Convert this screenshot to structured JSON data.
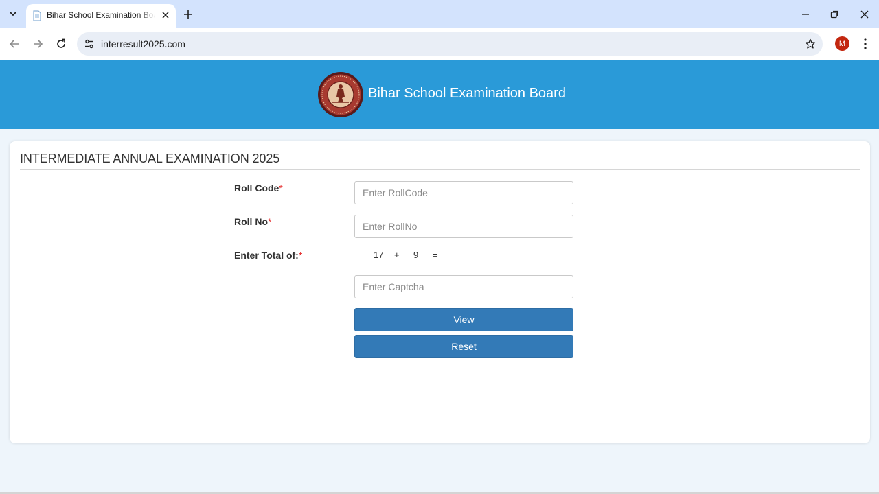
{
  "browser": {
    "tab_title": "Bihar School Examination Board",
    "url": "interresult2025.com",
    "profile_initial": "M",
    "icons": {
      "tab_menu": "chevron-down-icon",
      "favicon": "page-icon",
      "tab_close": "close-icon",
      "new_tab": "plus-icon",
      "minimize": "minimize-icon",
      "restore": "restore-icon",
      "close_window": "close-icon",
      "back": "arrow-left-icon",
      "forward": "arrow-right-icon",
      "reload": "reload-icon",
      "site_info": "tune-icon",
      "bookmark": "star-icon",
      "menu": "more-vert-icon"
    }
  },
  "header": {
    "title": "Bihar School Examination Board",
    "background_color": "#2a9ad8"
  },
  "form": {
    "heading": "INTERMEDIATE ANNUAL EXAMINATION 2025",
    "roll_code": {
      "label": "Roll Code",
      "required_mark": "*",
      "placeholder": "Enter RollCode",
      "value": ""
    },
    "roll_no": {
      "label": "Roll No",
      "required_mark": "*",
      "placeholder": "Enter RollNo",
      "value": ""
    },
    "captcha": {
      "label": "Enter Total of:",
      "required_mark": "*",
      "operand_a": "17",
      "operator": "+",
      "operand_b": "9",
      "equals": "=",
      "placeholder": "Enter Captcha",
      "value": ""
    },
    "view_button": "View",
    "reset_button": "Reset",
    "button_color": "#337ab7"
  }
}
